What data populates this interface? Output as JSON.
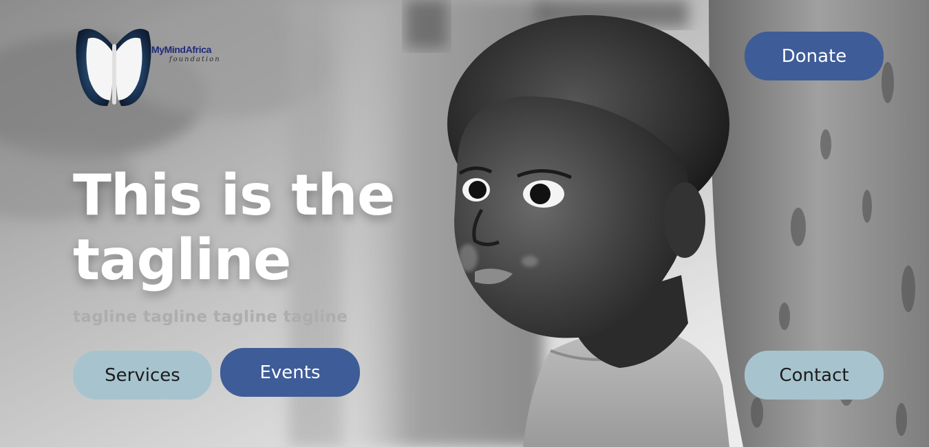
{
  "brand": {
    "name": "MyMindAfrica",
    "sub": "foundation",
    "logo_icon": "butterfly-icon",
    "colors": {
      "name_text": "#1f2a7a",
      "butterfly_dark": "#1b3050"
    }
  },
  "hero": {
    "headline_line1": "This is the",
    "headline_line2": "tagline",
    "subline": "tagline tagline tagline tagline",
    "background": "grayscale-photo-child-by-wall"
  },
  "buttons": {
    "donate": "Donate",
    "contact": "Contact",
    "services": "Services",
    "events": "Events"
  },
  "colors": {
    "pill_light": "#a7c4ce",
    "pill_dark": "#3e5c98",
    "headline": "#ffffff",
    "subline": "#adadad"
  }
}
